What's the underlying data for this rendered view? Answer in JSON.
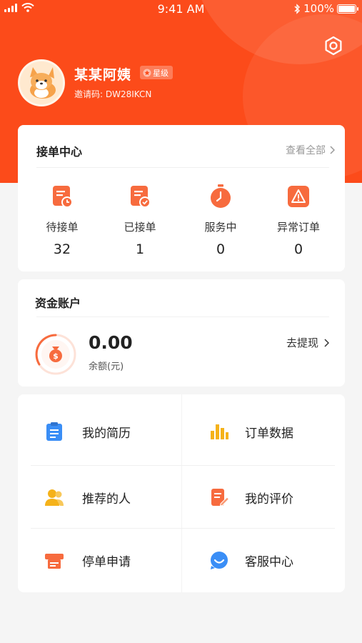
{
  "status_bar": {
    "time": "9:41 AM",
    "battery": "100%"
  },
  "profile": {
    "name": "某某阿姨",
    "level_badge": "星级",
    "invite_label": "邀请码: ",
    "invite_code": "DW28IKCN"
  },
  "order_center": {
    "title": "接单中心",
    "view_all": "查看全部",
    "items": [
      {
        "label": "待接单",
        "count": "32",
        "icon": "pending-orders-icon"
      },
      {
        "label": "已接单",
        "count": "1",
        "icon": "accepted-orders-icon"
      },
      {
        "label": "服务中",
        "count": "0",
        "icon": "in-service-timer-icon"
      },
      {
        "label": "异常订单",
        "count": "0",
        "icon": "abnormal-order-warning-icon"
      }
    ]
  },
  "fund_account": {
    "title": "资金账户",
    "balance": "0.00",
    "balance_label": "余额(元)",
    "withdraw": "去提现"
  },
  "menu": {
    "items": [
      {
        "label": "我的简历",
        "icon": "resume-clipboard-icon"
      },
      {
        "label": "订单数据",
        "icon": "bar-chart-icon"
      },
      {
        "label": "推荐的人",
        "icon": "referral-people-icon"
      },
      {
        "label": "我的评价",
        "icon": "review-edit-icon"
      },
      {
        "label": "停单申请",
        "icon": "stop-order-printer-icon"
      },
      {
        "label": "客服中心",
        "icon": "customer-service-chat-icon"
      }
    ]
  },
  "colors": {
    "brand": "#fc4b1a",
    "accent_orange": "#f76b3e",
    "blue": "#3a8ef6",
    "yellow": "#f5b21a"
  }
}
